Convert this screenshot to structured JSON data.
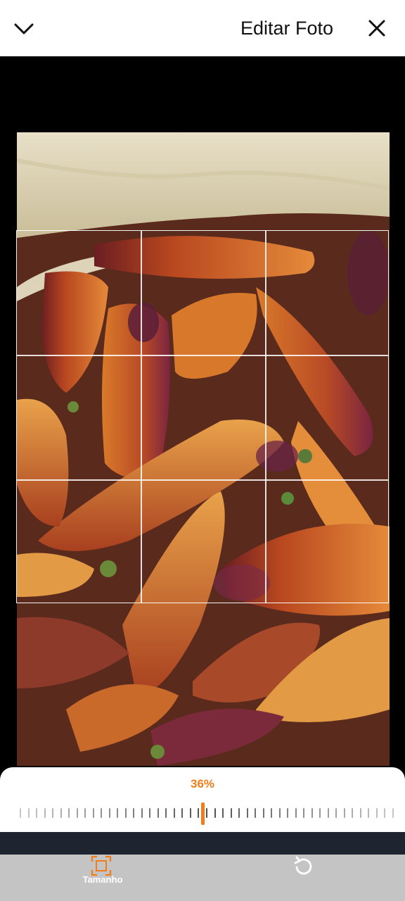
{
  "header": {
    "title": "Editar Foto",
    "close_icon": "close-icon",
    "collapse_icon": "chevron-down-icon"
  },
  "editor": {
    "zoom_label": "36%",
    "zoom_level": 36,
    "accent_color": "#f07d1a"
  },
  "toolbar": {
    "size_label": "Tamanho",
    "size_icon": "crop-frame-icon",
    "reset_icon": "rotate-reset-icon"
  }
}
